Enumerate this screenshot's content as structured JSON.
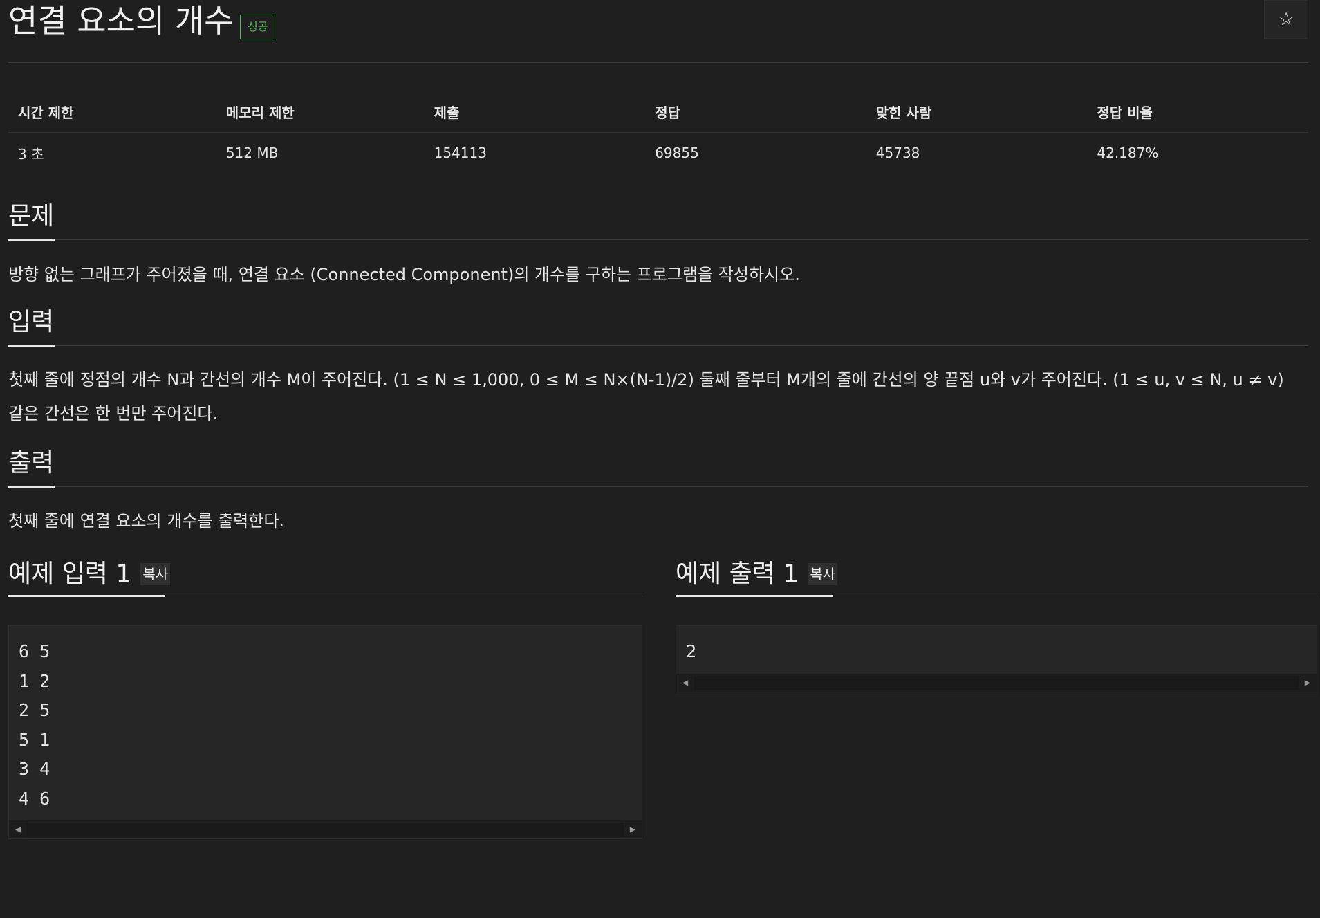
{
  "problem": {
    "title": "연결 요소의 개수",
    "badge": "성공",
    "star_icon": "☆"
  },
  "info": {
    "headers": [
      "시간 제한",
      "메모리 제한",
      "제출",
      "정답",
      "맞힌 사람",
      "정답 비율"
    ],
    "values": [
      "3 초",
      "512 MB",
      "154113",
      "69855",
      "45738",
      "42.187%"
    ]
  },
  "sections": {
    "problem": {
      "heading": "문제",
      "text": "방향 없는 그래프가 주어졌을 때, 연결 요소 (Connected Component)의 개수를 구하는 프로그램을 작성하시오."
    },
    "input": {
      "heading": "입력",
      "line1": "첫째 줄에 정점의 개수 N과 간선의 개수 M이 주어진다. (1 ≤ N ≤ 1,000, 0 ≤ M ≤ N×(N-1)/2) 둘째 줄부터 M개의 줄에 간선의 양 끝점 u와 v가 주어진다. (1 ≤ u, v ≤ N, u ≠ v)",
      "line2": "같은 간선은 한 번만 주어진다."
    },
    "output": {
      "heading": "출력",
      "text": "첫째 줄에 연결 요소의 개수를 출력한다."
    }
  },
  "samples": {
    "input": {
      "heading": "예제 입력 1",
      "copy_label": "복사",
      "lines": [
        "6 5",
        "1 2",
        "2 5",
        "5 1",
        "3 4",
        "4 6"
      ]
    },
    "output": {
      "heading": "예제 출력 1",
      "copy_label": "복사",
      "lines": [
        "2"
      ]
    }
  },
  "colors": {
    "background": "#1f1f1f",
    "badge_green": "#5cb85c",
    "text": "#e6e6e6"
  }
}
